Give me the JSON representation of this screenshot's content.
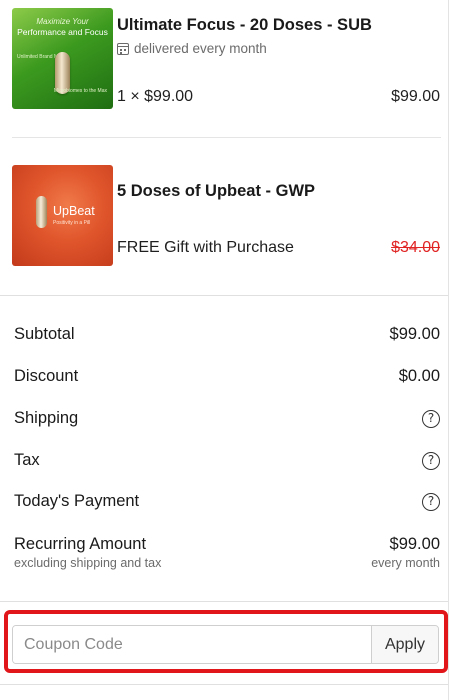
{
  "items": [
    {
      "thumbnail": {
        "heading_line1": "Maximize Your",
        "heading_line2": "Performance and Focus",
        "side_left": "Unlimited Brand Mode",
        "side_right": "Microbiomes to the Max"
      },
      "title": "Ultimate Focus - 20 Doses - SUB",
      "delivery_note": "delivered every month",
      "delivery_icon": "calendar-icon",
      "quantity_price": "1 × $99.00",
      "line_total": "$99.00"
    },
    {
      "thumbnail": {
        "brand": "UpBeat",
        "tagline": "Positivity in a Pill"
      },
      "title": "5 Doses of Upbeat - GWP",
      "gift_text": "FREE Gift with Purchase",
      "original_price": "$34.00",
      "original_price_color": "#e02424"
    }
  ],
  "summary": {
    "subtotal_label": "Subtotal",
    "subtotal_value": "$99.00",
    "discount_label": "Discount",
    "discount_value": "$0.00",
    "shipping_label": "Shipping",
    "tax_label": "Tax",
    "todays_payment_label": "Today's Payment",
    "help_glyph": "?",
    "help_icon": "question-circle-icon",
    "recurring_label": "Recurring Amount",
    "recurring_value": "$99.00",
    "recurring_note": "excluding shipping and tax",
    "recurring_frequency": "every month"
  },
  "coupon": {
    "placeholder": "Coupon Code",
    "value": "",
    "apply_label": "Apply",
    "highlight_color": "#e0161b"
  }
}
